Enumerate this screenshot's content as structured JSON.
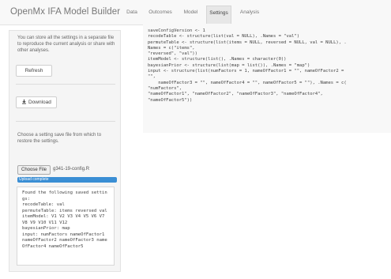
{
  "app": {
    "title": "OpenMx IFA Model Builder"
  },
  "nav": {
    "tabs": [
      {
        "label": "Data"
      },
      {
        "label": "Outcomes"
      },
      {
        "label": "Model"
      },
      {
        "label": "Settings"
      },
      {
        "label": "Analysis"
      }
    ],
    "active": "Settings"
  },
  "sidebar": {
    "intro": "You can store all the settings in a separate file to reproduce the current analysis or share with other analyses.",
    "refresh_label": "Refresh",
    "download_label": "Download",
    "download_icon": "download-icon",
    "restore_text": "Choose a setting save file from which to restore the settings.",
    "choose_file_label": "Choose File",
    "file_name": "g341-19-config.R",
    "upload_status": "Upload complete",
    "upload_progress_percent": 100,
    "output_lines": [
      "Found the following saved settings:",
      "",
      "recodeTable: val",
      "permuteTable: items reversed val",
      "itemModel: V1 V2 V3 V4 V5 V6 V7 V8 V9 V10 V11 V12",
      "bayesianPrior: map",
      "input: numFactors nameOfFactor1 nameOfFactor2 nameOfFactor3 nameOfFactor4 nameOfFactor5"
    ]
  },
  "code": {
    "lines": [
      "saveConfigVersion <- 1",
      "recodeTable <- structure(list(val = NULL), .Names = \"val\")",
      "permuteTable <- structure(list(items = NULL, reversed = NULL, val = NULL), .",
      "Names = c(\"items\",",
      "\"reversed\", \"val\"))",
      "itemModel <- structure(list(), .Names = character(0))",
      "bayesianPrior <- structure(list(map = list()), .Names = \"map\")",
      "input <- structure(list(numFactors = 1, nameOfFactor1 = \"\", nameOfFactor2 =",
      "\"\",",
      "    nameOfFactor3 = \"\", nameOfFactor4 = \"\", nameOfFactor5 = \"\"), .Names = c(",
      "\"numFactors\",",
      "\"nameOfFactor1\", \"nameOfFactor2\", \"nameOfFactor3\", \"nameOfFactor4\",",
      "\"nameOfFactor5\"))"
    ]
  },
  "colors": {
    "accent": "#3a8ed4",
    "navbar_bg": "#f8f8f8",
    "panel_bg": "#f5f5f5"
  }
}
